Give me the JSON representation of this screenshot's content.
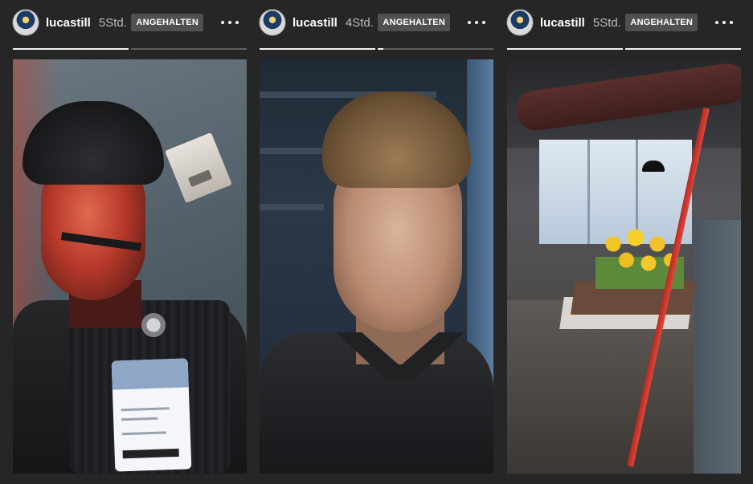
{
  "stories": [
    {
      "username": "lucastill",
      "time": "5Std.",
      "status": "ANGEHALTEN",
      "progress": [
        {
          "fill": 1.0
        },
        {
          "fill": 0.0
        }
      ],
      "image_text": {
        "badge_name": "A. Cruz",
        "badge_role": "Technician Level: A"
      }
    },
    {
      "username": "lucastill",
      "time": "4Std.",
      "status": "ANGEHALTEN",
      "progress": [
        {
          "fill": 1.0
        },
        {
          "fill": 0.05
        }
      ],
      "image_text": {}
    },
    {
      "username": "lucastill",
      "time": "5Std.",
      "status": "ANGEHALTEN",
      "progress": [
        {
          "fill": 1.0
        },
        {
          "fill": 1.0
        }
      ],
      "image_text": {}
    }
  ],
  "icons": {
    "more": "more-horizontal-icon",
    "avatar": "profile-avatar"
  },
  "colors": {
    "background": "#262626",
    "badge_bg": "#505050",
    "progress_track": "#5f5f5f",
    "progress_fill": "#f2f2f2"
  }
}
